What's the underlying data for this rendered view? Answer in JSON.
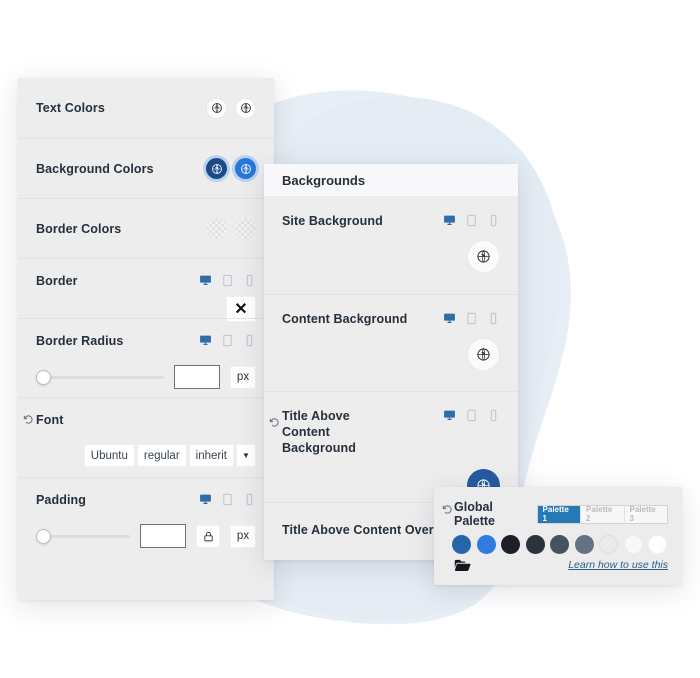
{
  "canvas": {
    "background": "#ffffff",
    "blob_color": "#e4ecf4"
  },
  "theme": {
    "panel_bg": "#ededee",
    "panel_header_bg": "#f8f8fa",
    "label_color": "#26303b",
    "device_active_color": "#2e6da8",
    "device_idle_color": "#c3ccd6",
    "accent_blue": "#2778b5",
    "swatch_darkblue": "#1b4a87",
    "swatch_blue": "#2878d8",
    "link_color": "#2c5f86"
  },
  "left_panel": {
    "rows": [
      {
        "label": "Text Colors",
        "kind": "swatches",
        "swatches": [
          {
            "name": "text-color-swatch-1",
            "style": "white",
            "icon": "globe-icon"
          },
          {
            "name": "text-color-swatch-2",
            "style": "white",
            "icon": "globe-icon"
          }
        ]
      },
      {
        "label": "Background Colors",
        "kind": "swatches",
        "swatches": [
          {
            "name": "background-color-swatch-1",
            "style": "darkblue",
            "icon": "globe-icon"
          },
          {
            "name": "background-color-swatch-2",
            "style": "blue",
            "icon": "globe-icon"
          }
        ]
      },
      {
        "label": "Border Colors",
        "kind": "swatches",
        "swatches": [
          {
            "name": "border-color-swatch-1",
            "style": "transparent-checker",
            "icon": "none"
          },
          {
            "name": "border-color-swatch-2",
            "style": "transparent-checker",
            "icon": "none"
          }
        ]
      },
      {
        "label": "Border",
        "kind": "clear-button",
        "devices": [
          "desktop-icon",
          "tablet-icon",
          "mobile-icon"
        ],
        "active_device": "desktop-icon",
        "clear_label": "✕"
      },
      {
        "label": "Border Radius",
        "kind": "slider-input",
        "devices": [
          "desktop-icon",
          "tablet-icon",
          "mobile-icon"
        ],
        "active_device": "desktop-icon",
        "slider_value": 0,
        "input_value": "",
        "input_placeholder": "",
        "unit": "px"
      },
      {
        "label": "Font",
        "kind": "font-selects",
        "has_reset": true,
        "selects": [
          {
            "name": "font-family-select",
            "value": "Ubuntu"
          },
          {
            "name": "font-weight-select",
            "value": "regular"
          },
          {
            "name": "font-style-select",
            "value": "inherit"
          }
        ],
        "caret": "▼"
      },
      {
        "label": "Padding",
        "kind": "slider-input-lock",
        "devices": [
          "desktop-icon",
          "tablet-icon",
          "mobile-icon"
        ],
        "active_device": "desktop-icon",
        "slider_value": 0,
        "input_value": "",
        "input_placeholder": "",
        "lock_icon": "lock-icon",
        "unit": "px"
      }
    ]
  },
  "backgrounds_panel": {
    "title": "Backgrounds",
    "rows": [
      {
        "label": "Site Background",
        "has_reset": false,
        "devices": [
          "desktop-icon",
          "tablet-icon",
          "mobile-icon"
        ],
        "active_device": "desktop-icon",
        "swatch": {
          "name": "site-background-swatch",
          "style": "white",
          "icon": "globe-icon"
        }
      },
      {
        "label": "Content Background",
        "has_reset": false,
        "devices": [
          "desktop-icon",
          "tablet-icon",
          "mobile-icon"
        ],
        "active_device": "desktop-icon",
        "swatch": {
          "name": "content-background-swatch",
          "style": "white",
          "icon": "globe-icon"
        }
      },
      {
        "label": "Title Above Content Background",
        "has_reset": true,
        "devices": [
          "desktop-icon",
          "tablet-icon",
          "mobile-icon"
        ],
        "active_device": "desktop-icon",
        "swatch": {
          "name": "title-above-content-background-swatch",
          "style": "blue",
          "icon": "globe-icon"
        }
      },
      {
        "label": "Title Above Content Overlay Color",
        "has_reset": false,
        "devices": [],
        "active_device": "",
        "swatch": null
      }
    ]
  },
  "global_palette": {
    "title": "Global Palette",
    "has_reset": true,
    "tabs": [
      {
        "label": "Palette 1",
        "active": true
      },
      {
        "label": "Palette 2",
        "active": false
      },
      {
        "label": "Palette 3",
        "active": false
      }
    ],
    "colors": [
      "#2566ab",
      "#2e7ce0",
      "#1b2026",
      "#2b323b",
      "#475260",
      "#647285",
      "#e7ebee",
      "#f6f8f9",
      "#ffffff"
    ],
    "folder_icon": "folder-icon",
    "link_label": "Learn how to use this"
  }
}
